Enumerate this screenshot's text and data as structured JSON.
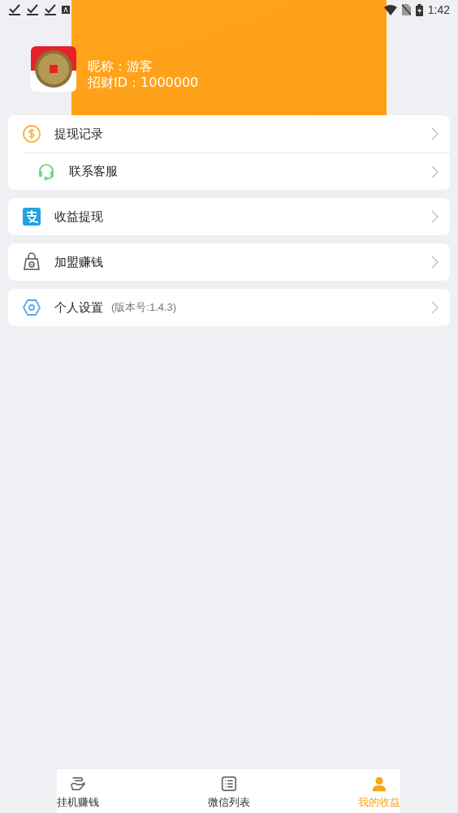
{
  "status_bar": {
    "time": "1:42"
  },
  "profile": {
    "nickname": "昵称：游客",
    "user_id": "招财ID：1000000"
  },
  "menu_groups": [
    {
      "items": [
        {
          "kind": "dollar",
          "label": "提现记录"
        },
        {
          "kind": "headset",
          "label": "联系客服"
        }
      ]
    },
    {
      "items": [
        {
          "kind": "pay",
          "label": "收益提现"
        }
      ]
    },
    {
      "items": [
        {
          "kind": "bag",
          "label": "加盟赚钱"
        }
      ]
    },
    {
      "items": [
        {
          "kind": "hexagon",
          "label": "个人设置",
          "note": "(版本号:1.4.3)"
        }
      ]
    }
  ],
  "bottom_nav": [
    {
      "kind": "hand",
      "label": "挂机赚钱",
      "selected": false
    },
    {
      "kind": "list",
      "label": "微信列表",
      "selected": false
    },
    {
      "kind": "person",
      "label": "我的收益",
      "selected": true
    }
  ]
}
